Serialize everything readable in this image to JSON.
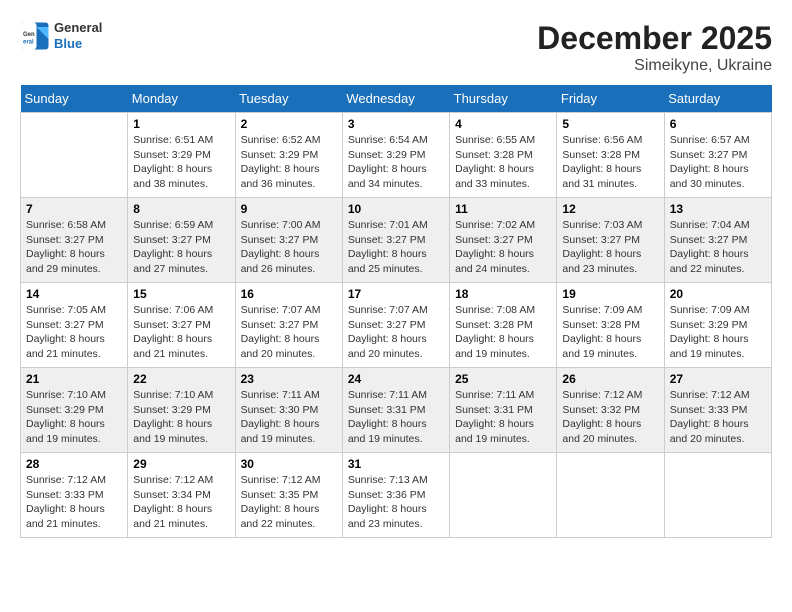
{
  "header": {
    "logo": {
      "general": "General",
      "blue": "Blue"
    },
    "month": "December 2025",
    "location": "Simeikyne, Ukraine"
  },
  "weekdays": [
    "Sunday",
    "Monday",
    "Tuesday",
    "Wednesday",
    "Thursday",
    "Friday",
    "Saturday"
  ],
  "days": [
    {
      "date": "",
      "sunrise": "",
      "sunset": "",
      "daylight": "",
      "daylight2": ""
    },
    {
      "date": "1",
      "sunrise": "Sunrise: 6:51 AM",
      "sunset": "Sunset: 3:29 PM",
      "daylight": "Daylight: 8 hours",
      "daylight2": "and 38 minutes."
    },
    {
      "date": "2",
      "sunrise": "Sunrise: 6:52 AM",
      "sunset": "Sunset: 3:29 PM",
      "daylight": "Daylight: 8 hours",
      "daylight2": "and 36 minutes."
    },
    {
      "date": "3",
      "sunrise": "Sunrise: 6:54 AM",
      "sunset": "Sunset: 3:29 PM",
      "daylight": "Daylight: 8 hours",
      "daylight2": "and 34 minutes."
    },
    {
      "date": "4",
      "sunrise": "Sunrise: 6:55 AM",
      "sunset": "Sunset: 3:28 PM",
      "daylight": "Daylight: 8 hours",
      "daylight2": "and 33 minutes."
    },
    {
      "date": "5",
      "sunrise": "Sunrise: 6:56 AM",
      "sunset": "Sunset: 3:28 PM",
      "daylight": "Daylight: 8 hours",
      "daylight2": "and 31 minutes."
    },
    {
      "date": "6",
      "sunrise": "Sunrise: 6:57 AM",
      "sunset": "Sunset: 3:27 PM",
      "daylight": "Daylight: 8 hours",
      "daylight2": "and 30 minutes."
    },
    {
      "date": "7",
      "sunrise": "Sunrise: 6:58 AM",
      "sunset": "Sunset: 3:27 PM",
      "daylight": "Daylight: 8 hours",
      "daylight2": "and 29 minutes."
    },
    {
      "date": "8",
      "sunrise": "Sunrise: 6:59 AM",
      "sunset": "Sunset: 3:27 PM",
      "daylight": "Daylight: 8 hours",
      "daylight2": "and 27 minutes."
    },
    {
      "date": "9",
      "sunrise": "Sunrise: 7:00 AM",
      "sunset": "Sunset: 3:27 PM",
      "daylight": "Daylight: 8 hours",
      "daylight2": "and 26 minutes."
    },
    {
      "date": "10",
      "sunrise": "Sunrise: 7:01 AM",
      "sunset": "Sunset: 3:27 PM",
      "daylight": "Daylight: 8 hours",
      "daylight2": "and 25 minutes."
    },
    {
      "date": "11",
      "sunrise": "Sunrise: 7:02 AM",
      "sunset": "Sunset: 3:27 PM",
      "daylight": "Daylight: 8 hours",
      "daylight2": "and 24 minutes."
    },
    {
      "date": "12",
      "sunrise": "Sunrise: 7:03 AM",
      "sunset": "Sunset: 3:27 PM",
      "daylight": "Daylight: 8 hours",
      "daylight2": "and 23 minutes."
    },
    {
      "date": "13",
      "sunrise": "Sunrise: 7:04 AM",
      "sunset": "Sunset: 3:27 PM",
      "daylight": "Daylight: 8 hours",
      "daylight2": "and 22 minutes."
    },
    {
      "date": "14",
      "sunrise": "Sunrise: 7:05 AM",
      "sunset": "Sunset: 3:27 PM",
      "daylight": "Daylight: 8 hours",
      "daylight2": "and 21 minutes."
    },
    {
      "date": "15",
      "sunrise": "Sunrise: 7:06 AM",
      "sunset": "Sunset: 3:27 PM",
      "daylight": "Daylight: 8 hours",
      "daylight2": "and 21 minutes."
    },
    {
      "date": "16",
      "sunrise": "Sunrise: 7:07 AM",
      "sunset": "Sunset: 3:27 PM",
      "daylight": "Daylight: 8 hours",
      "daylight2": "and 20 minutes."
    },
    {
      "date": "17",
      "sunrise": "Sunrise: 7:07 AM",
      "sunset": "Sunset: 3:27 PM",
      "daylight": "Daylight: 8 hours",
      "daylight2": "and 20 minutes."
    },
    {
      "date": "18",
      "sunrise": "Sunrise: 7:08 AM",
      "sunset": "Sunset: 3:28 PM",
      "daylight": "Daylight: 8 hours",
      "daylight2": "and 19 minutes."
    },
    {
      "date": "19",
      "sunrise": "Sunrise: 7:09 AM",
      "sunset": "Sunset: 3:28 PM",
      "daylight": "Daylight: 8 hours",
      "daylight2": "and 19 minutes."
    },
    {
      "date": "20",
      "sunrise": "Sunrise: 7:09 AM",
      "sunset": "Sunset: 3:29 PM",
      "daylight": "Daylight: 8 hours",
      "daylight2": "and 19 minutes."
    },
    {
      "date": "21",
      "sunrise": "Sunrise: 7:10 AM",
      "sunset": "Sunset: 3:29 PM",
      "daylight": "Daylight: 8 hours",
      "daylight2": "and 19 minutes."
    },
    {
      "date": "22",
      "sunrise": "Sunrise: 7:10 AM",
      "sunset": "Sunset: 3:29 PM",
      "daylight": "Daylight: 8 hours",
      "daylight2": "and 19 minutes."
    },
    {
      "date": "23",
      "sunrise": "Sunrise: 7:11 AM",
      "sunset": "Sunset: 3:30 PM",
      "daylight": "Daylight: 8 hours",
      "daylight2": "and 19 minutes."
    },
    {
      "date": "24",
      "sunrise": "Sunrise: 7:11 AM",
      "sunset": "Sunset: 3:31 PM",
      "daylight": "Daylight: 8 hours",
      "daylight2": "and 19 minutes."
    },
    {
      "date": "25",
      "sunrise": "Sunrise: 7:11 AM",
      "sunset": "Sunset: 3:31 PM",
      "daylight": "Daylight: 8 hours",
      "daylight2": "and 19 minutes."
    },
    {
      "date": "26",
      "sunrise": "Sunrise: 7:12 AM",
      "sunset": "Sunset: 3:32 PM",
      "daylight": "Daylight: 8 hours",
      "daylight2": "and 20 minutes."
    },
    {
      "date": "27",
      "sunrise": "Sunrise: 7:12 AM",
      "sunset": "Sunset: 3:33 PM",
      "daylight": "Daylight: 8 hours",
      "daylight2": "and 20 minutes."
    },
    {
      "date": "28",
      "sunrise": "Sunrise: 7:12 AM",
      "sunset": "Sunset: 3:33 PM",
      "daylight": "Daylight: 8 hours",
      "daylight2": "and 21 minutes."
    },
    {
      "date": "29",
      "sunrise": "Sunrise: 7:12 AM",
      "sunset": "Sunset: 3:34 PM",
      "daylight": "Daylight: 8 hours",
      "daylight2": "and 21 minutes."
    },
    {
      "date": "30",
      "sunrise": "Sunrise: 7:12 AM",
      "sunset": "Sunset: 3:35 PM",
      "daylight": "Daylight: 8 hours",
      "daylight2": "and 22 minutes."
    },
    {
      "date": "31",
      "sunrise": "Sunrise: 7:13 AM",
      "sunset": "Sunset: 3:36 PM",
      "daylight": "Daylight: 8 hours",
      "daylight2": "and 23 minutes."
    }
  ]
}
